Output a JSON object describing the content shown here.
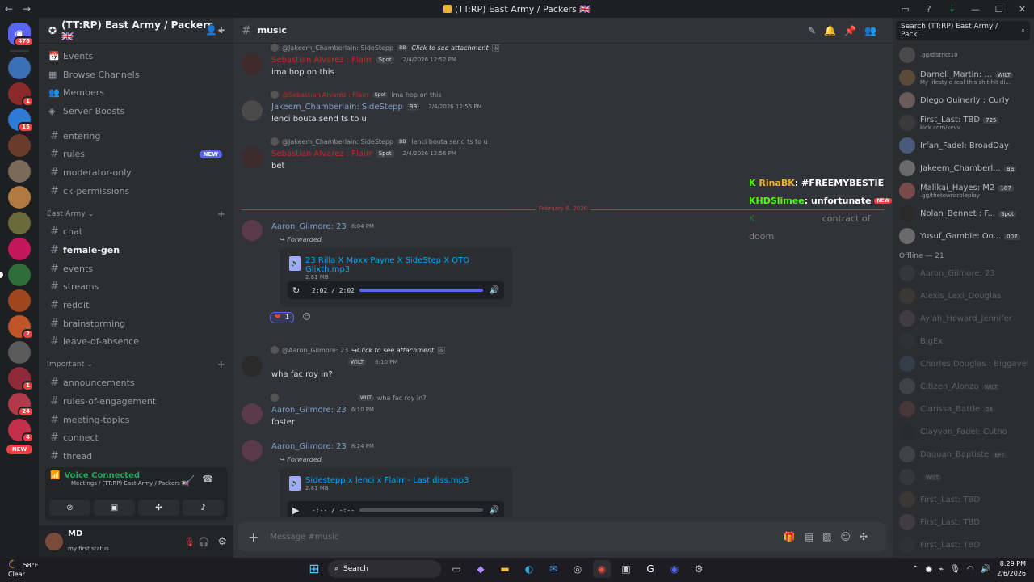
{
  "window": {
    "title": "(TT:RP) East Army / Packers 🇬🇧",
    "back_icon": "←",
    "forward_icon": "→"
  },
  "guilds": {
    "home_badge": "476",
    "badges": [
      "1",
      "15",
      "2",
      "1",
      "24",
      "4"
    ],
    "new_label": "NEW"
  },
  "server": {
    "name": "(TT:RP) East Army / Packers 🇬🇧",
    "nav": [
      {
        "icon": "📅",
        "label": "Events"
      },
      {
        "icon": "▦",
        "label": "Browse Channels"
      },
      {
        "icon": "👥",
        "label": "Members"
      },
      {
        "icon": "◈",
        "label": "Server Boosts"
      }
    ],
    "top_channels": [
      {
        "name": "entering"
      },
      {
        "name": "rules",
        "badge": "NEW"
      },
      {
        "name": "moderator-only"
      },
      {
        "name": "ck-permissions"
      }
    ],
    "category1": "East Army",
    "category1_channels": [
      "chat",
      "female-gen",
      "events",
      "streams",
      "reddit",
      "brainstorming",
      "leave-of-absence"
    ],
    "category2": "Important",
    "category2_channels": [
      "announcements",
      "rules-of-engagement",
      "meeting-topics",
      "connect",
      "thread"
    ]
  },
  "voice": {
    "status": "Voice Connected",
    "location": "Meetings / (TT:RP) East Army / Packers 🇬🇧"
  },
  "user": {
    "name": "MD",
    "status": "my first status"
  },
  "channel": {
    "name": "music",
    "placeholder": "Message #music"
  },
  "messages": [
    {
      "reply_author": "@Jakeem_Chamberlain: SideStepp",
      "reply_tag": "BB",
      "reply_text": "Click to see attachment",
      "author": "Sebastian Alvarez : Flairr",
      "author_color": "#c62828",
      "tag": "Spot",
      "time": "2/4/2026 12:52 PM",
      "text": "ima hop on this"
    },
    {
      "reply_author": "@Sebastian Alvarez : Flairr",
      "reply_tag": "Spot",
      "reply_text": "ima hop on this",
      "author": "Jakeem_Chamberlain: SideStepp",
      "author_color": "#7ea0c8",
      "tag": "BB",
      "time": "2/4/2026 12:56 PM",
      "text": "lenci bouta send ts to u"
    },
    {
      "reply_author": "@Jakeem_Chamberlain: SideStepp",
      "reply_tag": "BB",
      "reply_text": "lenci bouta send ts to u",
      "author": "Sebastian Alvarez : Flairr",
      "author_color": "#c62828",
      "tag": "Spot",
      "time": "2/4/2026 12:56 PM",
      "text": "bet"
    },
    {
      "author": "Aaron_Gilmore: 23",
      "author_color": "#7ea0c8",
      "time": "6:04 PM",
      "forwarded": "Forwarded",
      "file": "23 Rilla X Maxx Payne X SideStep X OTO Glixth.mp3",
      "size": "2.81 MB",
      "player": "2:02 / 2:02",
      "progress": 1.0,
      "reaction_count": "1"
    },
    {
      "reply_author": "@Aaron_Gilmore: 23",
      "reply_text": "Click to see attachment",
      "tag": "WILT",
      "time": "6:10 PM",
      "text": "wha fac roy in?"
    },
    {
      "reply_tag": "WILT",
      "reply_text": "wha fac roy in?",
      "author": "Aaron_Gilmore: 23",
      "author_color": "#7ea0c8",
      "time": "6:10 PM",
      "text": "foster"
    },
    {
      "author": "Aaron_Gilmore: 23",
      "author_color": "#7ea0c8",
      "time": "8:24 PM",
      "forwarded": "Forwarded",
      "file": "Sidestepp x lenci x Flairr - Last diss.mp3",
      "size": "2.81 MB",
      "player": "-:-- / -:--",
      "progress": 0.0
    }
  ],
  "divider": "February 6, 2026",
  "overlay": {
    "line1_name": "RinaBK",
    "line1_text": "#FREEMYBESTIE",
    "line2_name": "HDSlimee",
    "line2_text": "unfortunate",
    "line3_text": "contract of doom",
    "new_label": "NEW"
  },
  "members": {
    "search": "Search (TT:RP) East Army / Pack...",
    "online": [
      {
        "name": "",
        "sub": ".gg/district10"
      },
      {
        "name": "Darnell_Martin: ...",
        "tag": "WILT",
        "sub": "My lifestyle real this shit hit di..."
      },
      {
        "name": "Diego Quinerly : Curly"
      },
      {
        "name": "First_Last: TBD",
        "tag": "725",
        "sub": "kick.com/kevv"
      },
      {
        "name": "Irfan_Fadel: BroadDay"
      },
      {
        "name": "Jakeem_Chamberl...",
        "tag": "BB"
      },
      {
        "name": "Malikai_Hayes: M2",
        "tag": "187",
        "sub": ".gg/thetownsroleplay"
      },
      {
        "name": "Nolan_Bennet : F...",
        "tag": "Spot"
      },
      {
        "name": "Yusuf_Gamble: Oo...",
        "tag": "007"
      }
    ],
    "offline_header": "Offline — 21",
    "offline": [
      {
        "name": "Aaron_Gilmore: 23"
      },
      {
        "name": "Alexis_Lexi_Douglas"
      },
      {
        "name": "Aylah_Howard_Jennifer"
      },
      {
        "name": "BigEx"
      },
      {
        "name": "Charles Douglas : Biggavelli"
      },
      {
        "name": "Citizen_Alonzo",
        "tag": "WILT"
      },
      {
        "name": "Clarissa_Battle",
        "tag": "26"
      },
      {
        "name": "Clayvon_Fadel: Cutho"
      },
      {
        "name": "Daquan_Baptiste",
        "tag": "EFT"
      },
      {
        "name": "",
        "tag": "WILT"
      },
      {
        "name": "First_Last: TBD"
      },
      {
        "name": "First_Last: TBD"
      },
      {
        "name": "First_Last: TBD"
      }
    ]
  },
  "taskbar": {
    "temp": "58°F",
    "weather": "Clear",
    "search": "Search",
    "time": "8:29 PM",
    "date": "2/6/2026"
  }
}
